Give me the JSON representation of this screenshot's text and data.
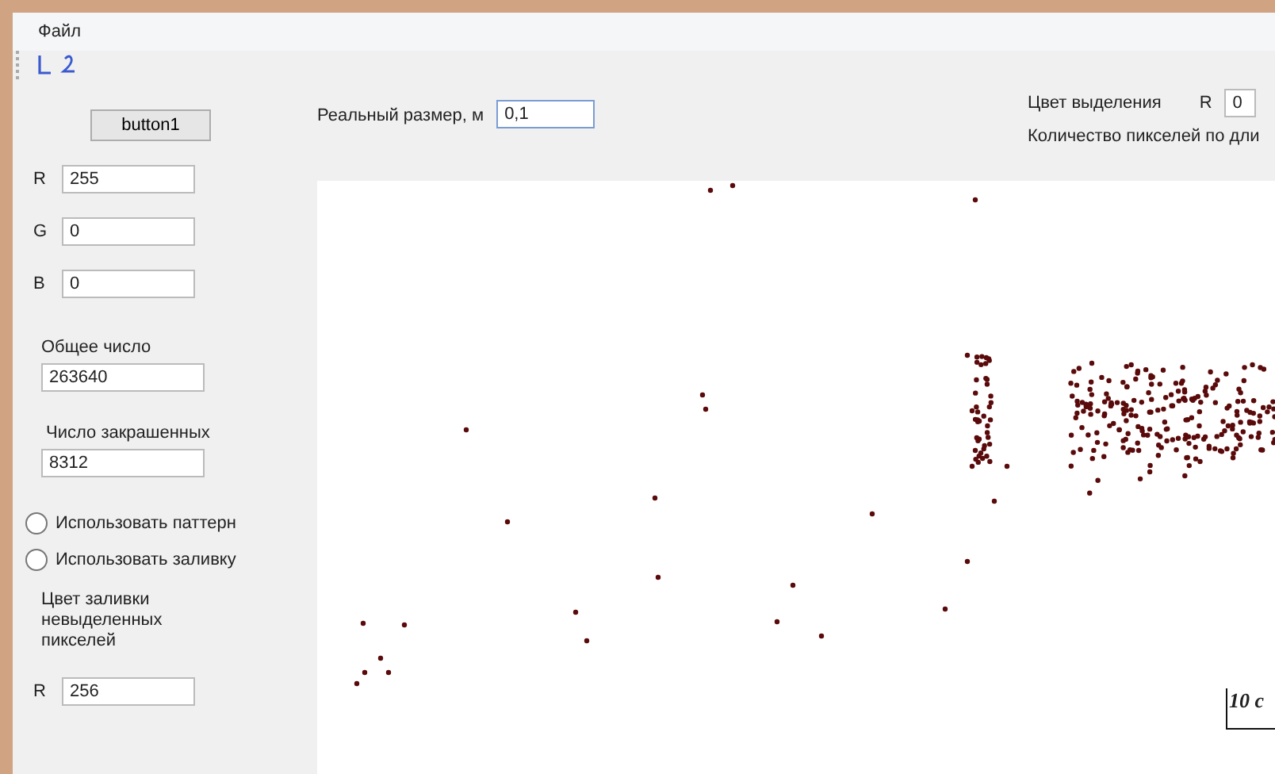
{
  "menu": [
    "Файл"
  ],
  "left_panel": {
    "button": "button1",
    "rgb": [
      {
        "label": "R",
        "value": "255"
      },
      {
        "label": "G",
        "value": "0"
      },
      {
        "label": "B",
        "value": "0"
      }
    ],
    "total": {
      "label": "Общее число",
      "value": "263640"
    },
    "painted": {
      "label": "Число закрашенных",
      "value": "8312"
    },
    "options": [
      {
        "label": "Использовать паттерн",
        "selected": false
      },
      {
        "label": "Использовать заливку",
        "selected": false
      }
    ],
    "fill_color": {
      "label": "Цвет заливки невыделенных пикселей",
      "r_label": "R",
      "r_value": "256"
    }
  },
  "top": {
    "size_label": "Реальный размер, м",
    "size_value": "0,1",
    "highlight_label": "Цвет выделения",
    "highlight_r_label": "R",
    "highlight_r_value": "0",
    "pixels_label": "Количество пикселей по дли"
  },
  "image": {
    "scale_label": "10 с"
  }
}
